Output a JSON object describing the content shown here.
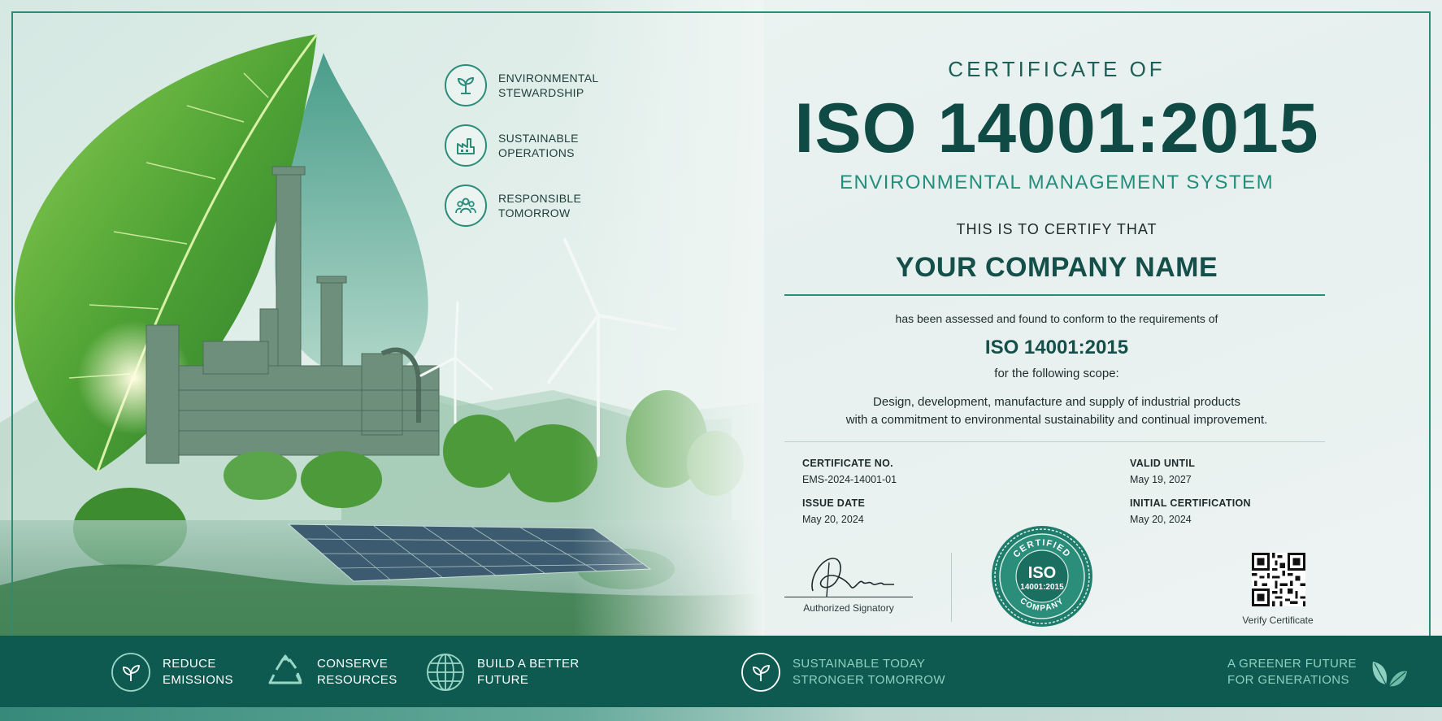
{
  "badges": [
    {
      "label": "ENVIRONMENTAL\nSTEWARDSHIP",
      "icon": "sprout-icon"
    },
    {
      "label": "SUSTAINABLE\nOPERATIONS",
      "icon": "factory-icon"
    },
    {
      "label": "RESPONSIBLE\nTOMORROW",
      "icon": "people-icon"
    }
  ],
  "certificate": {
    "heading": "CERTIFICATE OF",
    "standard": "ISO 14001:2015",
    "system": "ENVIRONMENTAL MANAGEMENT SYSTEM",
    "certify_that": "THIS IS TO CERTIFY THAT",
    "company": "YOUR COMPANY NAME",
    "assessed": "has been assessed and found to conform to the requirements of",
    "standard_small": "ISO 14001:2015",
    "scope_label": "for the following scope:",
    "scope_line1": "Design, development, manufacture and supply of industrial products",
    "scope_line2": "with a commitment to environmental sustainability and continual improvement."
  },
  "details": {
    "certificate_no": {
      "label": "CERTIFICATE NO.",
      "value": "EMS-2024-14001-01"
    },
    "issue_date": {
      "label": "ISSUE DATE",
      "value": "May 20, 2024"
    },
    "valid_until": {
      "label": "VALID UNTIL",
      "value": "May 19, 2027"
    },
    "initial_certification": {
      "label": "INITIAL CERTIFICATION",
      "value": "May 20, 2024"
    }
  },
  "signature": {
    "label": "Authorized Signatory"
  },
  "seal": {
    "top_text": "CERTIFIED",
    "iso": "ISO",
    "standard": "14001:2015",
    "bottom_text": "COMPANY"
  },
  "qr": {
    "label": "Verify Certificate",
    "icon": "qr-code-icon"
  },
  "banner": [
    {
      "label": "REDUCE\nEMISSIONS",
      "icon": "leaf-circle-icon"
    },
    {
      "label": "CONSERVE\nRESOURCES",
      "icon": "recycle-icon"
    },
    {
      "label": "BUILD A BETTER\nFUTURE",
      "icon": "globe-icon"
    },
    {
      "label": "SUSTAINABLE TODAY\nSTRONGER TOMORROW",
      "icon": "leaf-circle-icon"
    },
    {
      "label": "A GREENER FUTURE\nFOR GENERATIONS",
      "icon": "leaves-icon"
    }
  ],
  "colors": {
    "primary": "#0f4a45",
    "accent": "#248d7b",
    "banner": "#0e5a51"
  }
}
